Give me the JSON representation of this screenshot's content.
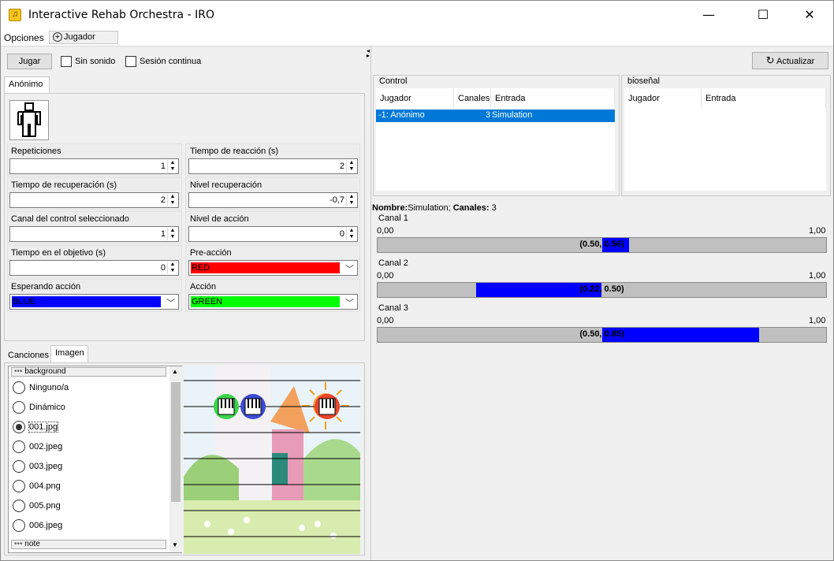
{
  "window": {
    "title": "Interactive Rehab Orchestra - IRO",
    "minimize": "—",
    "maximize": "☐",
    "close": "✕"
  },
  "menu": {
    "opciones": "Opciones",
    "jugador": "Jugador"
  },
  "toolbar": {
    "play_label": "Jugar",
    "no_sound_label": "Sin sonido",
    "continuous_label": "Sesión continua",
    "update_label": "Actualizar"
  },
  "player_tab": "Anónimo",
  "fields": {
    "repeticiones": {
      "label": "Repeticiones",
      "value": "1"
    },
    "tiempo_reaccion": {
      "label": "Tiempo de reacción (s)",
      "value": "2"
    },
    "tiempo_recuperacion": {
      "label": "Tiempo de recuperación (s)",
      "value": "2"
    },
    "nivel_recuperacion": {
      "label": "Nivel recuperación",
      "value": "-0,7"
    },
    "canal_control": {
      "label": "Canal del control seleccionado",
      "value": "1"
    },
    "nivel_accion": {
      "label": "Nivel de acción",
      "value": "0"
    },
    "tiempo_objetivo": {
      "label": "Tiempo en el objetivo (s)",
      "value": "0"
    },
    "pre_accion": {
      "label": "Pre-acción",
      "value": "RED",
      "color": "#ff0000"
    },
    "esperando_accion": {
      "label": "Esperando acción",
      "value": "BLUE",
      "color": "#0000ff"
    },
    "accion": {
      "label": "Acción",
      "value": "GREEN",
      "color": "#00ff00"
    }
  },
  "bottom_tabs": [
    "Canciones",
    "Imagen"
  ],
  "image_list": {
    "section_background": "background",
    "items": [
      "Ninguno/a",
      "Dinámico",
      "001.jpg",
      "002.jpeg",
      "003.jpeg",
      "004.png",
      "005.png",
      "006.jpeg"
    ],
    "selected": "001.jpg",
    "section_note": "note"
  },
  "control_table": {
    "title": "Control",
    "columns": [
      "Jugador",
      "Canales",
      "Entrada"
    ],
    "rows": [
      {
        "jugador": "-1: Anónimo",
        "canales": "3",
        "entrada": "Simulation"
      }
    ]
  },
  "biosignal_table": {
    "title": "bioseñal",
    "columns": [
      "Jugador",
      "Entrada"
    ]
  },
  "channel_info": {
    "nombre_label": "Nombre:",
    "nombre_value": "Simulation;",
    "canales_label": "Canales:",
    "canales_value": "3"
  },
  "channels": [
    {
      "label": "Canal 1",
      "min": "0,00",
      "max": "1,00",
      "range_text": "(0.50, 0.56)",
      "from": 0.5,
      "to": 0.56
    },
    {
      "label": "Canal 2",
      "min": "0,00",
      "max": "1,00",
      "range_text": "(0.22, 0.50)",
      "from": 0.22,
      "to": 0.5
    },
    {
      "label": "Canal 3",
      "min": "0,00",
      "max": "1,00",
      "range_text": "(0.50, 0.85)",
      "from": 0.5,
      "to": 0.85
    }
  ]
}
